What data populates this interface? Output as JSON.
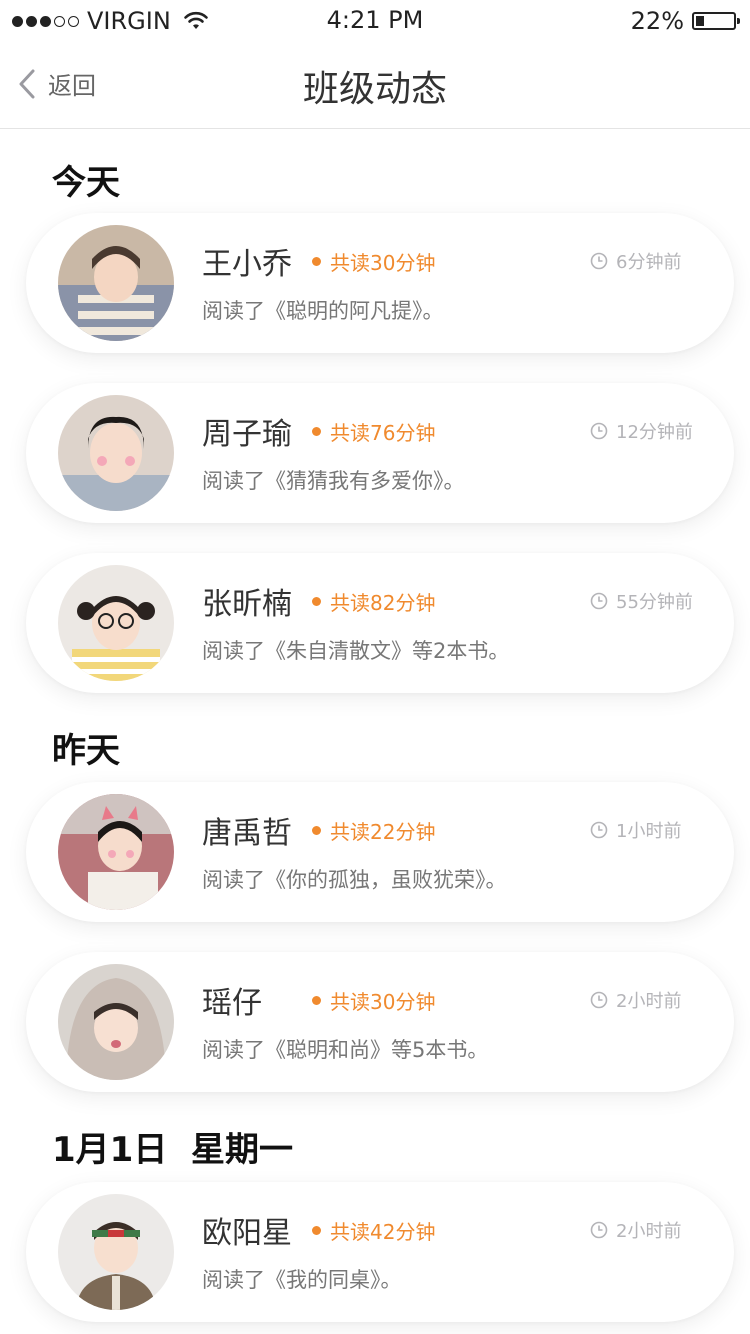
{
  "status_bar": {
    "carrier": "VIRGIN",
    "time": "4:21 PM",
    "battery": "22%",
    "battery_level": 0.22,
    "signal_bars_filled": 3,
    "signal_bars_total": 5
  },
  "nav": {
    "back_label": "返回",
    "title": "班级动态"
  },
  "colors": {
    "accent": "#f08a2e",
    "muted": "#b4b4b8"
  },
  "sections": [
    {
      "header": "今天",
      "items": [
        {
          "name": "王小乔",
          "badge": "共读30分钟",
          "time": "6分钟前",
          "desc": "阅读了《聪明的阿凡提》。"
        },
        {
          "name": "周子瑜",
          "badge": "共读76分钟",
          "time": "12分钟前",
          "desc": "阅读了《猜猜我有多爱你》。"
        },
        {
          "name": "张昕楠",
          "badge": "共读82分钟",
          "time": "55分钟前",
          "desc": "阅读了《朱自清散文》等2本书。"
        }
      ]
    },
    {
      "header": "昨天",
      "items": [
        {
          "name": "唐禹哲",
          "badge": "共读22分钟",
          "time": "1小时前",
          "desc": "阅读了《你的孤独，虽败犹荣》。"
        },
        {
          "name": "瑶仔",
          "badge": "共读30分钟",
          "time": "2小时前",
          "desc": "阅读了《聪明和尚》等5本书。"
        }
      ]
    },
    {
      "header": "1月1日  星期一",
      "items": [
        {
          "name": "欧阳星",
          "badge": "共读42分钟",
          "time": "2小时前",
          "desc": "阅读了《我的同桌》。"
        }
      ]
    }
  ]
}
